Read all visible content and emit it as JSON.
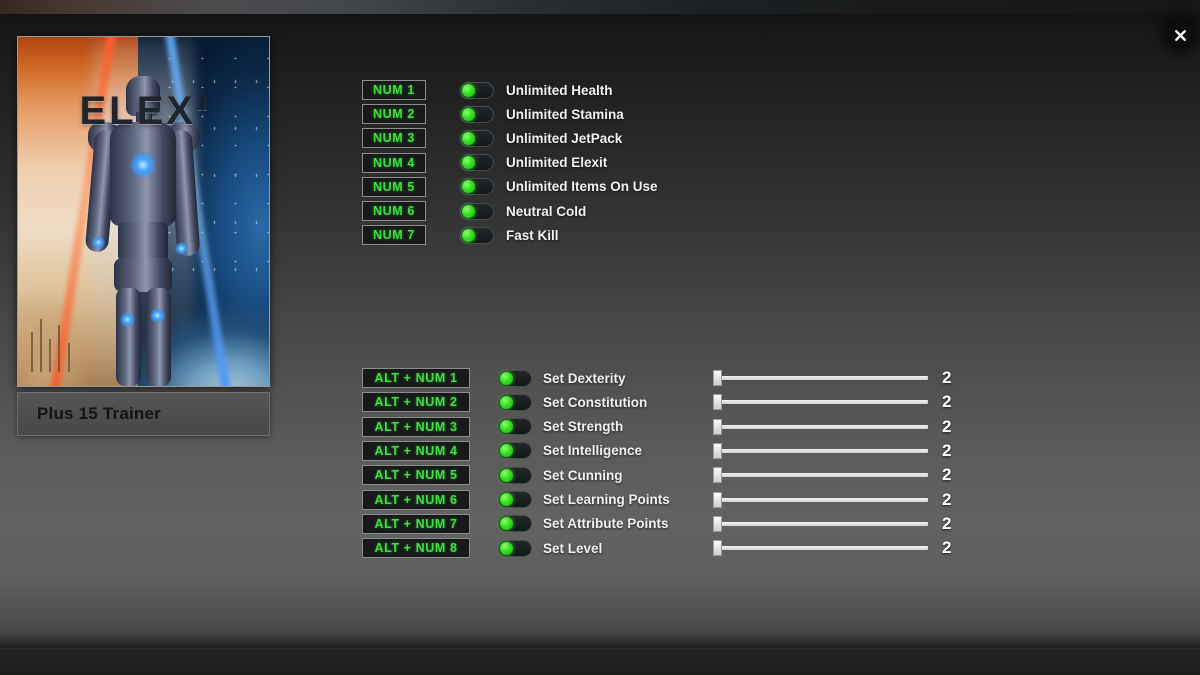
{
  "window": {
    "close_icon": "close-icon"
  },
  "cover": {
    "logo_main": "ELEX",
    "logo_sup": "II",
    "alt": "ELEX II cover art"
  },
  "trainer": {
    "title": "Plus 15 Trainer"
  },
  "toggle_options": [
    {
      "hotkey": "NUM 1",
      "label": "Unlimited Health",
      "state": "on"
    },
    {
      "hotkey": "NUM 2",
      "label": "Unlimited Stamina",
      "state": "on"
    },
    {
      "hotkey": "NUM 3",
      "label": "Unlimited JetPack",
      "state": "on"
    },
    {
      "hotkey": "NUM 4",
      "label": "Unlimited Elexit",
      "state": "on"
    },
    {
      "hotkey": "NUM 5",
      "label": "Unlimited Items On Use",
      "state": "on"
    },
    {
      "hotkey": "NUM 6",
      "label": "Neutral Cold",
      "state": "on"
    },
    {
      "hotkey": "NUM 7",
      "label": "Fast Kill",
      "state": "on"
    }
  ],
  "slider_options": [
    {
      "hotkey": "ALT + NUM 1",
      "label": "Set Dexterity",
      "state": "on",
      "value": "2"
    },
    {
      "hotkey": "ALT + NUM 2",
      "label": "Set Constitution",
      "state": "on",
      "value": "2"
    },
    {
      "hotkey": "ALT + NUM 3",
      "label": "Set Strength",
      "state": "on",
      "value": "2"
    },
    {
      "hotkey": "ALT + NUM 4",
      "label": "Set Intelligence",
      "state": "on",
      "value": "2"
    },
    {
      "hotkey": "ALT + NUM 5",
      "label": "Set Cunning",
      "state": "on",
      "value": "2"
    },
    {
      "hotkey": "ALT + NUM 6",
      "label": "Set Learning Points",
      "state": "on",
      "value": "2"
    },
    {
      "hotkey": "ALT + NUM 7",
      "label": "Set Attribute Points",
      "state": "on",
      "value": "2"
    },
    {
      "hotkey": "ALT + NUM 8",
      "label": "Set Level",
      "state": "on",
      "value": "2"
    }
  ],
  "colors": {
    "hotkey_text": "#3fe03f",
    "toggle_on": "#34e021",
    "label_text": "#f2f2f2",
    "slider_track": "#f2f2f2"
  }
}
